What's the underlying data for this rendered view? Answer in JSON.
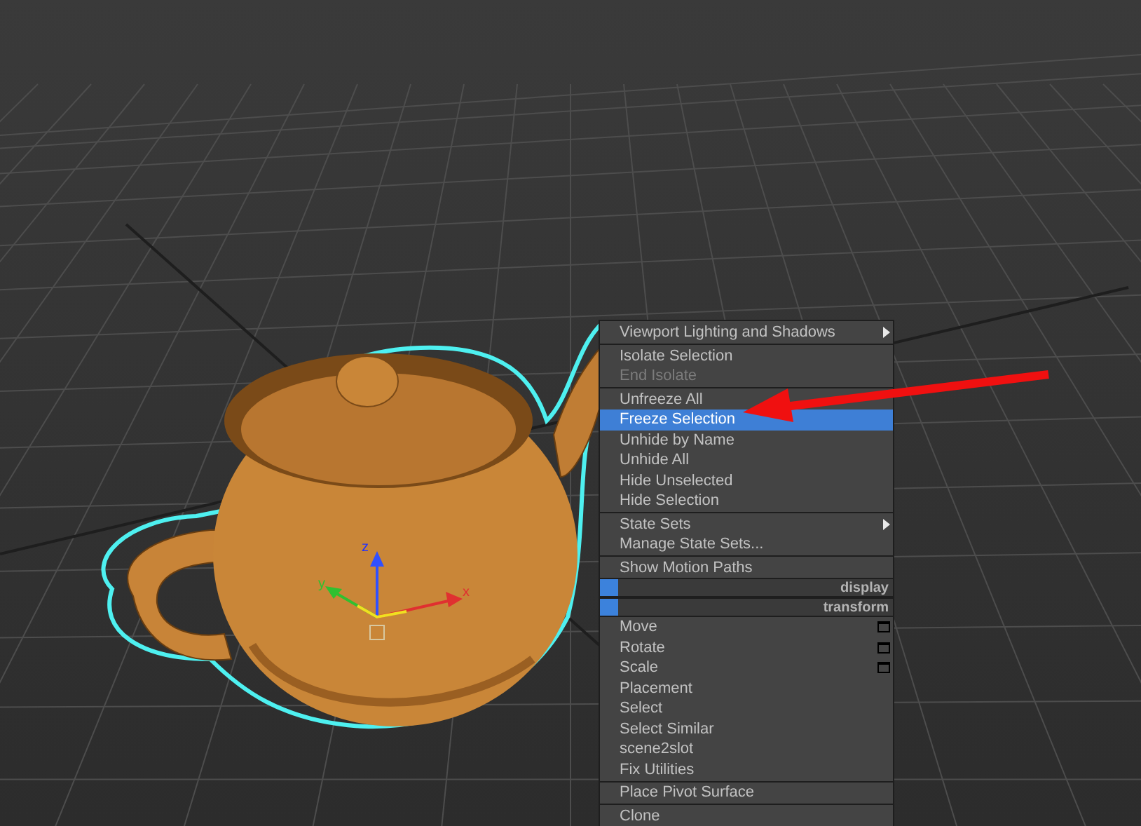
{
  "viewport": {
    "gizmo": {
      "axes": [
        {
          "label": "x"
        },
        {
          "label": "y"
        },
        {
          "label": "z"
        }
      ]
    },
    "menu": {
      "items": [
        {
          "kind": "item",
          "label": "Viewport Lighting and Shadows",
          "disabled": false,
          "selected": false,
          "submenu": true,
          "options": false
        },
        {
          "kind": "separator"
        },
        {
          "kind": "item",
          "label": "Isolate Selection",
          "disabled": false,
          "selected": false,
          "submenu": false,
          "options": false
        },
        {
          "kind": "item",
          "label": "End Isolate",
          "disabled": true,
          "selected": false,
          "submenu": false,
          "options": false
        },
        {
          "kind": "separator"
        },
        {
          "kind": "item",
          "label": "Unfreeze All",
          "disabled": false,
          "selected": false,
          "submenu": false,
          "options": false
        },
        {
          "kind": "item",
          "label": "Freeze Selection",
          "disabled": false,
          "selected": true,
          "submenu": false,
          "options": false
        },
        {
          "kind": "item",
          "label": "Unhide by Name",
          "disabled": false,
          "selected": false,
          "submenu": false,
          "options": false
        },
        {
          "kind": "item",
          "label": "Unhide All",
          "disabled": false,
          "selected": false,
          "submenu": false,
          "options": false
        },
        {
          "kind": "item",
          "label": "Hide Unselected",
          "disabled": false,
          "selected": false,
          "submenu": false,
          "options": false
        },
        {
          "kind": "item",
          "label": "Hide Selection",
          "disabled": false,
          "selected": false,
          "submenu": false,
          "options": false
        },
        {
          "kind": "separator"
        },
        {
          "kind": "item",
          "label": "State Sets",
          "disabled": false,
          "selected": false,
          "submenu": true,
          "options": false
        },
        {
          "kind": "item",
          "label": "Manage State Sets...",
          "disabled": false,
          "selected": false,
          "submenu": false,
          "options": false
        },
        {
          "kind": "separator"
        },
        {
          "kind": "item",
          "label": "Show Motion Paths",
          "disabled": false,
          "selected": false,
          "submenu": false,
          "options": false
        },
        {
          "kind": "header",
          "label": "display"
        },
        {
          "kind": "header",
          "label": "transform"
        },
        {
          "kind": "item",
          "label": "Move",
          "disabled": false,
          "selected": false,
          "submenu": false,
          "options": true
        },
        {
          "kind": "item",
          "label": "Rotate",
          "disabled": false,
          "selected": false,
          "submenu": false,
          "options": true
        },
        {
          "kind": "item",
          "label": "Scale",
          "disabled": false,
          "selected": false,
          "submenu": false,
          "options": true
        },
        {
          "kind": "item",
          "label": "Placement",
          "disabled": false,
          "selected": false,
          "submenu": false,
          "options": false
        },
        {
          "kind": "item",
          "label": "Select",
          "disabled": false,
          "selected": false,
          "submenu": false,
          "options": false
        },
        {
          "kind": "item",
          "label": "Select Similar",
          "disabled": false,
          "selected": false,
          "submenu": false,
          "options": false
        },
        {
          "kind": "item",
          "label": "scene2slot",
          "disabled": false,
          "selected": false,
          "submenu": false,
          "options": false
        },
        {
          "kind": "item",
          "label": "Fix Utilities",
          "disabled": false,
          "selected": false,
          "submenu": false,
          "options": false
        },
        {
          "kind": "separator"
        },
        {
          "kind": "item",
          "label": "Place Pivot Surface",
          "disabled": false,
          "selected": false,
          "submenu": false,
          "options": false
        },
        {
          "kind": "separator"
        },
        {
          "kind": "item",
          "label": "Clone",
          "disabled": false,
          "selected": false,
          "submenu": false,
          "options": false
        }
      ]
    }
  }
}
